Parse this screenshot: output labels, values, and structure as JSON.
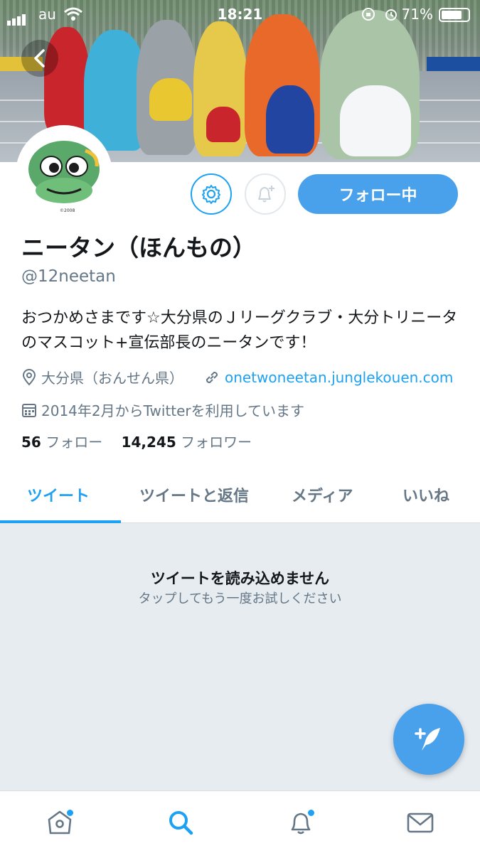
{
  "status_bar": {
    "carrier": "au",
    "time": "18:21",
    "battery": "71%"
  },
  "profile": {
    "follow_button": "フォロー中",
    "display_name": "ニータン（ほんもの）",
    "handle": "@12neetan",
    "bio": "おつかめさまです☆大分県のＪリーグクラブ・大分トリニータのマスコット+宣伝部長のニータンです！",
    "location": "大分県（おんせん県）",
    "website": "onetwoneetan.junglekouen.com",
    "joined": "2014年2月からTwitterを利用しています",
    "following_count": "56",
    "following_label": "フォロー",
    "followers_count": "14,245",
    "followers_label": "フォロワー"
  },
  "tabs": [
    {
      "label": "ツイート",
      "active": true
    },
    {
      "label": "ツイートと返信",
      "active": false
    },
    {
      "label": "メディア",
      "active": false
    },
    {
      "label": "いいね",
      "active": false
    }
  ],
  "content": {
    "error_title": "ツイートを読み込めません",
    "error_subtitle": "タップしてもう一度お試しください"
  },
  "colors": {
    "accent": "#1da1f2",
    "button": "#4aa1eb",
    "muted": "#657786",
    "background": "#e6ecf0"
  },
  "icons": {
    "back": "chevron-left-icon",
    "settings": "gear-icon",
    "notify": "bell-plus-icon",
    "location": "location-pin-icon",
    "link": "link-icon",
    "joined": "calendar-icon",
    "compose": "compose-feather-icon",
    "nav": [
      "home-icon",
      "search-icon",
      "bell-icon",
      "mail-icon"
    ]
  }
}
